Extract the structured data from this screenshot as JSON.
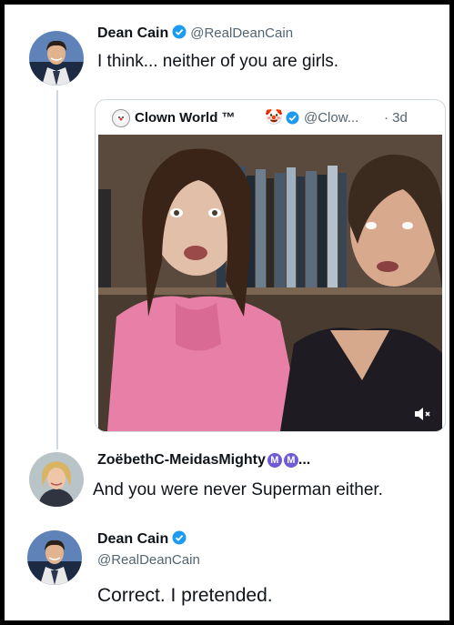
{
  "tweet1": {
    "author_name": "Dean Cain",
    "author_handle": "@RealDeanCain",
    "text": "I think... neither of you are girls."
  },
  "quoted": {
    "author_name": "Clown World ™",
    "author_handle": "@Clow...",
    "timestamp": "· 3d",
    "clown_emoji": "🤡"
  },
  "reply1": {
    "author_name": "ZoëbethC-MeidasMighty",
    "badge_letter": "M",
    "ellipsis": "...",
    "text": "And you were never Superman either."
  },
  "reply2": {
    "author_name": "Dean Cain",
    "author_handle": "@RealDeanCain",
    "text": "Correct. I pretended."
  },
  "colors": {
    "verified_blue": "#1d9bf0",
    "meidas_badge": "#6f5bd6",
    "handle_gray": "#536471"
  }
}
